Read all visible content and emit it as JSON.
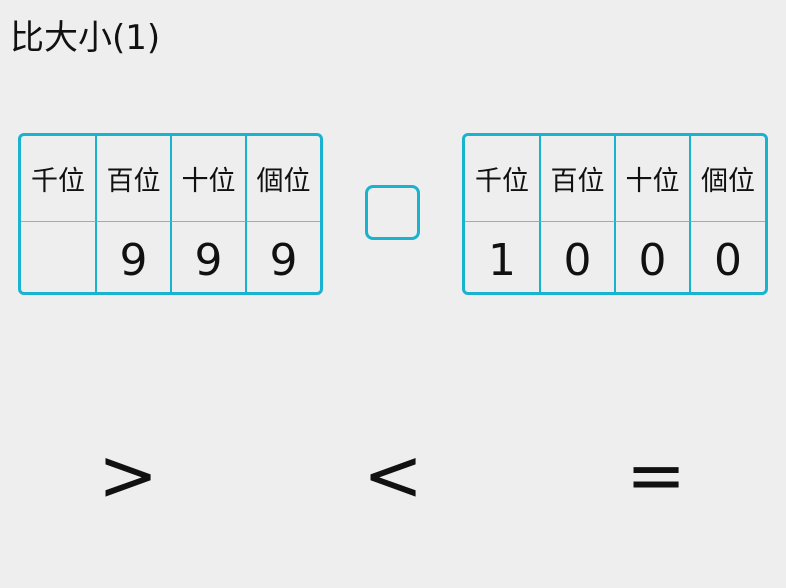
{
  "title": "比大小(1)",
  "accent_color": "#1ab3cf",
  "left_table": {
    "headers": [
      "千位",
      "百位",
      "十位",
      "個位"
    ],
    "digits": [
      "",
      "9",
      "9",
      "9"
    ]
  },
  "right_table": {
    "headers": [
      "千位",
      "百位",
      "十位",
      "個位"
    ],
    "digits": [
      "1",
      "0",
      "0",
      "0"
    ]
  },
  "answer_box": {
    "value": ""
  },
  "choices": {
    "greater": ">",
    "less": "<",
    "equal": "="
  }
}
